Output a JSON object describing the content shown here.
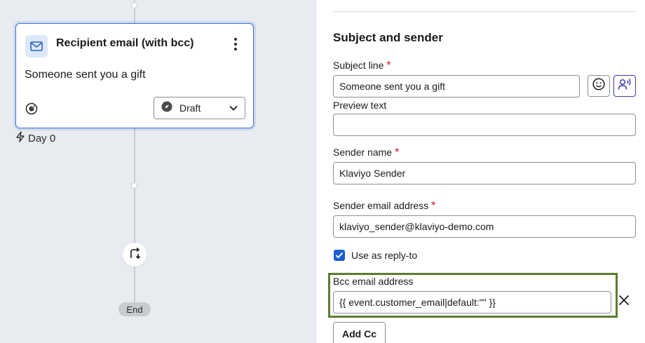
{
  "flow": {
    "card": {
      "title": "Recipient email (with bcc)",
      "subtitle": "Someone sent you a gift",
      "status": "Draft",
      "icons": {
        "type": "mail-icon",
        "menu": "more-vertical-icon",
        "analytics": "analytics-icon",
        "status": "compass-icon",
        "dropdown": "chevron-down-icon"
      }
    },
    "delay": {
      "label": "Day 0",
      "icon": "lightning-icon"
    },
    "branch_icon": "split-branch-icon",
    "end_label": "End"
  },
  "panel": {
    "section_title": "Subject and sender",
    "subject": {
      "label": "Subject line",
      "required": "*",
      "value": "Someone sent you a gift",
      "emoji_icon": "smiley-icon",
      "ai_icon": "speaker-icon"
    },
    "preview": {
      "label": "Preview text",
      "value": ""
    },
    "sender_name": {
      "label": "Sender name",
      "required": "*",
      "value": "Klaviyo Sender"
    },
    "sender_email": {
      "label": "Sender email address",
      "required": "*",
      "value": "klaviyo_sender@klaviyo-demo.com"
    },
    "reply_to": {
      "label": "Use as reply-to",
      "checked": true
    },
    "bcc": {
      "label": "Bcc email address",
      "value": "{{ event.customer_email|default:\"\" }}",
      "remove_icon": "close-icon"
    },
    "add_cc_label": "Add Cc"
  },
  "colors": {
    "accent": "#1a5fd1",
    "card_border": "#3b6fd6",
    "highlight": "#5b7d2f",
    "required": "#c8102e"
  }
}
